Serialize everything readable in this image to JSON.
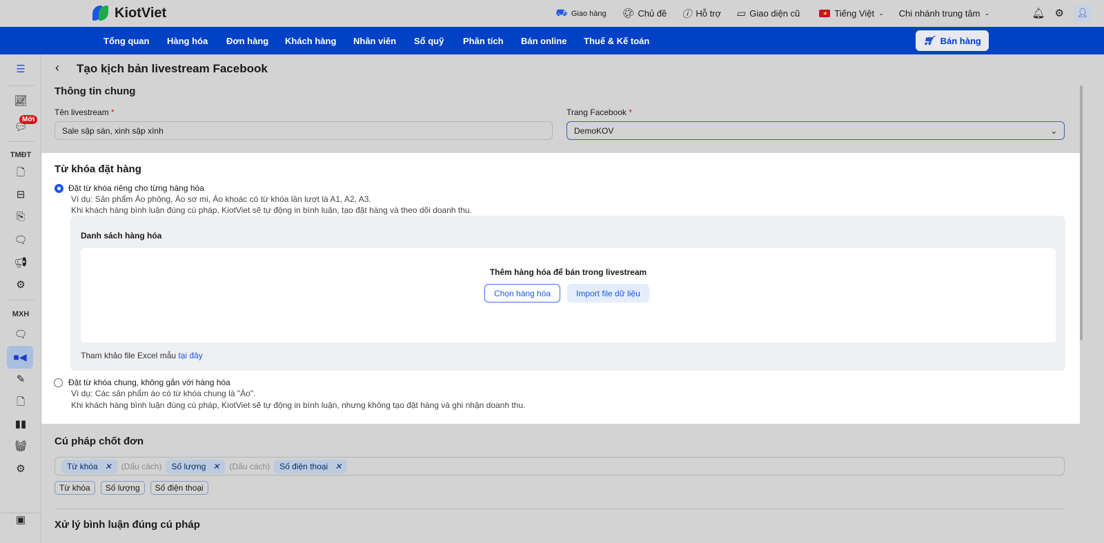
{
  "header": {
    "logo": "KiotViet",
    "items": [
      {
        "icon": "delivery-icon",
        "label": "Giao hàng"
      },
      {
        "icon": "palette-icon",
        "label": "Chủ đề"
      },
      {
        "icon": "support-icon",
        "label": "Hỗ trợ"
      },
      {
        "icon": "monitor-icon",
        "label": "Giao diện cũ"
      },
      {
        "icon": "vn-flag-icon",
        "label": "Tiếng Việt"
      },
      {
        "label": "Chi nhánh trung tâm"
      }
    ]
  },
  "nav": {
    "items": [
      "Tổng quan",
      "Hàng hóa",
      "Đơn hàng",
      "Khách hàng",
      "Nhân viên",
      "Sổ quỹ",
      "Phân tích",
      "Bán online",
      "Thuế & Kế toán"
    ],
    "sell": "Bán hàng"
  },
  "sidebar": {
    "badge": "Mới",
    "section_ecom": "TMĐT",
    "section_social": "MXH"
  },
  "page": {
    "title": "Tạo kịch bản livestream Facebook",
    "general": {
      "heading": "Thông tin chung",
      "name_label": "Tên livestream",
      "name_value": "Sale sập sàn, xinh sập xình",
      "page_label": "Trang Facebook",
      "page_value": "DemoKOV",
      "required": "*"
    },
    "keywords": {
      "heading": "Từ khóa đặt hàng",
      "opt1": {
        "label": "Đặt từ khóa riêng cho từng hàng hóa",
        "line1": "Ví dụ: Sản phẩm Áo phông, Áo sơ mi, Áo khoác có từ khóa lần lượt là A1, A2, A3.",
        "line2": "Khi khách hàng bình luận đúng cú pháp, KiotViet sẽ tự động in bình luận, tạo đặt hàng và theo dõi doanh thu.",
        "selected": true
      },
      "list_title": "Danh sách hàng hóa",
      "empty_text": "Thêm hàng hóa để bán trong livestream",
      "choose": "Chọn hàng hóa",
      "import": "Import file dữ liệu",
      "ref_text": "Tham khảo file Excel mẫu",
      "ref_link": "tại đây",
      "opt2": {
        "label": "Đặt từ khóa chung, không gắn với hàng hóa",
        "line1": "Ví dụ: Các sản phẩm áo có từ khóa chung là \"Áo\".",
        "line2": "Khi khách hàng bình luận đúng cú pháp, KiotViet sẽ tự động in bình luận, nhưng không tạo đặt hàng và ghi nhận doanh thu.",
        "selected": false
      }
    },
    "syntax": {
      "heading": "Cú pháp chốt đơn",
      "chips": [
        "Từ khóa",
        "Số lượng",
        "Số điện thoại"
      ],
      "separator": "(Dấu cách)",
      "tags": [
        "Từ khóa",
        "Số lượng",
        "Số điện thoại"
      ]
    },
    "process": {
      "heading": "Xử lý bình luận đúng cú pháp"
    }
  },
  "colors": {
    "nav": "#0041c6",
    "accent": "#1a56e8",
    "required": "#d8111a"
  }
}
